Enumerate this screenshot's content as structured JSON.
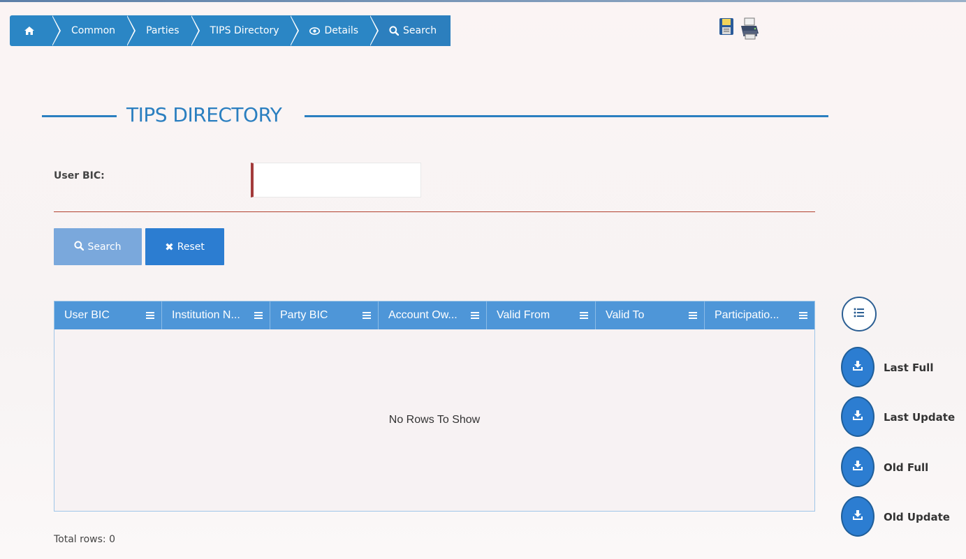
{
  "breadcrumb": {
    "home_icon": "home-icon",
    "items": [
      "Common",
      "Parties",
      "TIPS Directory",
      "Details",
      "Search"
    ]
  },
  "toolbar": {
    "save_icon": "floppy-disk-icon",
    "print_icon": "printer-icon"
  },
  "page": {
    "title": "TIPS DIRECTORY"
  },
  "form": {
    "user_bic_label": "User BIC:",
    "user_bic_value": ""
  },
  "buttons": {
    "search": "Search",
    "reset": "Reset"
  },
  "grid": {
    "columns": [
      "User BIC",
      "Institution N...",
      "Party BIC",
      "Account Ow...",
      "Valid From",
      "Valid To",
      "Participatio..."
    ],
    "empty_text": "No Rows To Show",
    "total_rows_text": "Total rows: 0"
  },
  "downloads": [
    "Last Full",
    "Last Update",
    "Old Full",
    "Old Update"
  ],
  "colors": {
    "accent": "#2b86c5",
    "header": "#4e96d8",
    "mandatory": "#a33b3b"
  }
}
